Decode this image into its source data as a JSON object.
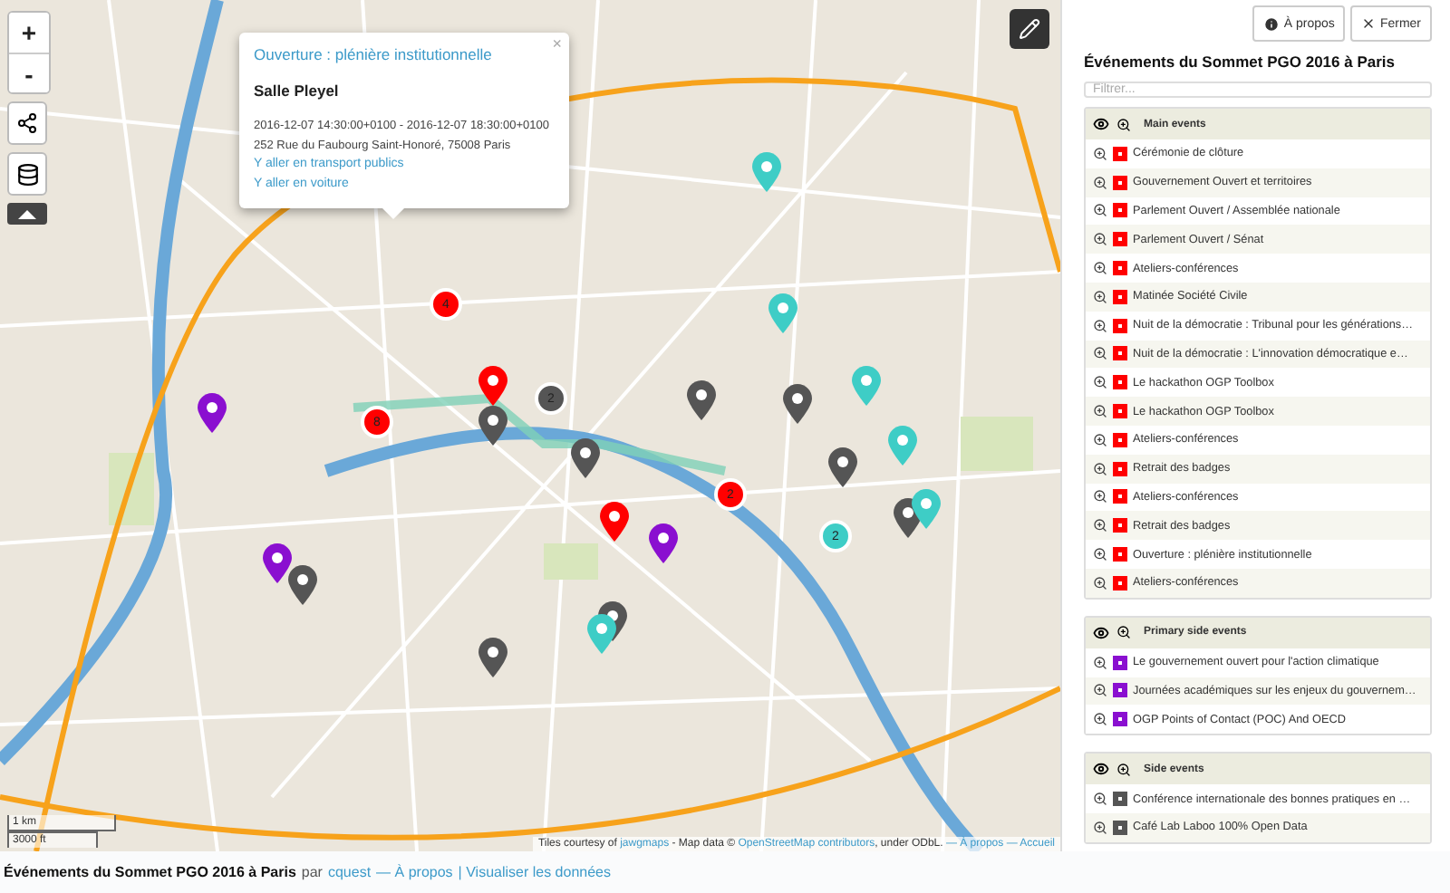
{
  "map": {
    "zoom_in": "+",
    "zoom_out": "-",
    "scale": [
      "1 km",
      "3000 ft"
    ],
    "attribution": {
      "prefix": "Tiles courtesy of",
      "tiles_link": "jawgmaps",
      "middle": "- Map data ©",
      "osm_link": "OpenStreetMap contributors",
      "license": ", under ODbL.",
      "links": [
        "— À propos",
        "— Accueil"
      ]
    },
    "popup": {
      "title": "Ouverture : plénière institutionnelle",
      "venue": "Salle Pleyel",
      "dates": "2016-12-07 14:30:00+0100 - 2016-12-07 18:30:00+0100",
      "address": "252 Rue du Faubourg Saint-Honoré, 75008 Paris",
      "links": [
        "Y aller en transport publics",
        "Y aller en voiture"
      ],
      "close": "×"
    },
    "markers": [
      {
        "kind": "cluster",
        "color": "#ff0000",
        "label": "4"
      },
      {
        "kind": "cluster",
        "color": "#ff0000",
        "label": "8"
      },
      {
        "kind": "cluster",
        "color": "#ff0000",
        "label": "2"
      },
      {
        "kind": "cluster",
        "color": "#555555",
        "label": "2"
      },
      {
        "kind": "cluster",
        "color": "#3ecdc6",
        "label": "2"
      },
      {
        "kind": "pin",
        "color": "#ff0000"
      },
      {
        "kind": "pin",
        "color": "#ff0000"
      },
      {
        "kind": "pin",
        "color": "#8a0fd0"
      },
      {
        "kind": "pin",
        "color": "#8a0fd0"
      },
      {
        "kind": "pin",
        "color": "#8a0fd0"
      },
      {
        "kind": "pin",
        "color": "#555555"
      },
      {
        "kind": "pin",
        "color": "#555555"
      },
      {
        "kind": "pin",
        "color": "#555555"
      },
      {
        "kind": "pin",
        "color": "#555555"
      },
      {
        "kind": "pin",
        "color": "#555555"
      },
      {
        "kind": "pin",
        "color": "#555555"
      },
      {
        "kind": "pin",
        "color": "#555555"
      },
      {
        "kind": "pin",
        "color": "#555555"
      },
      {
        "kind": "pin",
        "color": "#555555"
      },
      {
        "kind": "pin",
        "color": "#3ecdc6"
      },
      {
        "kind": "pin",
        "color": "#3ecdc6"
      },
      {
        "kind": "pin",
        "color": "#3ecdc6"
      },
      {
        "kind": "pin",
        "color": "#3ecdc6"
      },
      {
        "kind": "pin",
        "color": "#3ecdc6"
      },
      {
        "kind": "pin",
        "color": "#3ecdc6"
      }
    ]
  },
  "sidebar": {
    "buttons": [
      {
        "kind": "about",
        "label": "À propos"
      },
      {
        "kind": "close",
        "label": "Fermer"
      }
    ],
    "title": "Événements du Sommet PGO 2016 à Paris",
    "filter": {
      "placeholder": "Filtrer..."
    },
    "groups": [
      {
        "name": "Main events",
        "color": "#ff0000",
        "items": [
          "Cérémonie de clôture",
          "Gouvernement Ouvert et territoires",
          "Parlement Ouvert / Assemblée nationale",
          "Parlement Ouvert / Sénat",
          "Ateliers-conférences",
          "Matinée Société Civile",
          "Nuit de la démocratie : Tribunal pour les générations…",
          "Nuit de la démocratie : L'innovation démocratique e…",
          "Le hackathon OGP Toolbox",
          "Le hackathon OGP Toolbox",
          "Ateliers-conférences",
          "Retrait des badges",
          "Ateliers-conférences",
          "Retrait des badges",
          "Ouverture : plénière institutionnelle",
          "Ateliers-conférences"
        ]
      },
      {
        "name": "Primary side events",
        "color": "#8a0fd0",
        "items": [
          "Le gouvernement ouvert pour l'action climatique",
          "Journées académiques sur les enjeux du gouvernem…",
          "OGP Points of Contact (POC) And OECD"
        ]
      },
      {
        "name": "Side events",
        "color": "#555555",
        "items": [
          "Conférence internationale des bonnes pratiques en …",
          "Café Lab Laboo 100% Open Data"
        ]
      }
    ]
  },
  "footer": {
    "title": "Événements du Sommet PGO 2016 à Paris",
    "by": "par",
    "author": "cquest",
    "links": [
      "— À propos",
      "| Visualiser les données"
    ]
  }
}
